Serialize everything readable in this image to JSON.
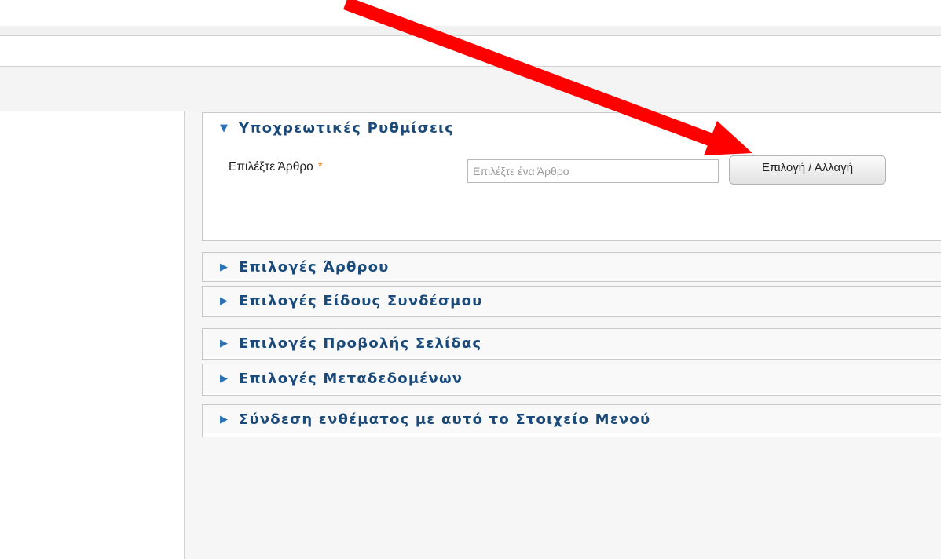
{
  "panels": {
    "required_settings": {
      "title": "Υποχρεωτικές Ρυθμίσεις",
      "expanded": true,
      "field_label": "Επιλέξτε Άρθρο",
      "required_mark": "*",
      "input_placeholder": "Επιλέξτε ένα Άρθρο",
      "input_value": "",
      "button_label": "Επιλογή / Αλλαγή"
    },
    "collapsed": [
      {
        "title": "Επιλογές Άρθρου"
      },
      {
        "title": "Επιλογές Είδους Συνδέσμου"
      },
      {
        "title": "Επιλογές Προβολής Σελίδας"
      },
      {
        "title": "Επιλογές Μεταδεδομένων"
      },
      {
        "title": "Σύνδεση ενθέματος με αυτό το Στοιχείο Μενού"
      }
    ]
  },
  "icons": {
    "expanded": "triangle-down-icon",
    "collapsed": "triangle-right-icon",
    "annotation": "red-arrow-icon"
  },
  "colors": {
    "heading": "#1a4a7a",
    "triangle": "#2a72b8",
    "required_star": "#e8831c",
    "annotation_arrow": "#ff0000"
  }
}
